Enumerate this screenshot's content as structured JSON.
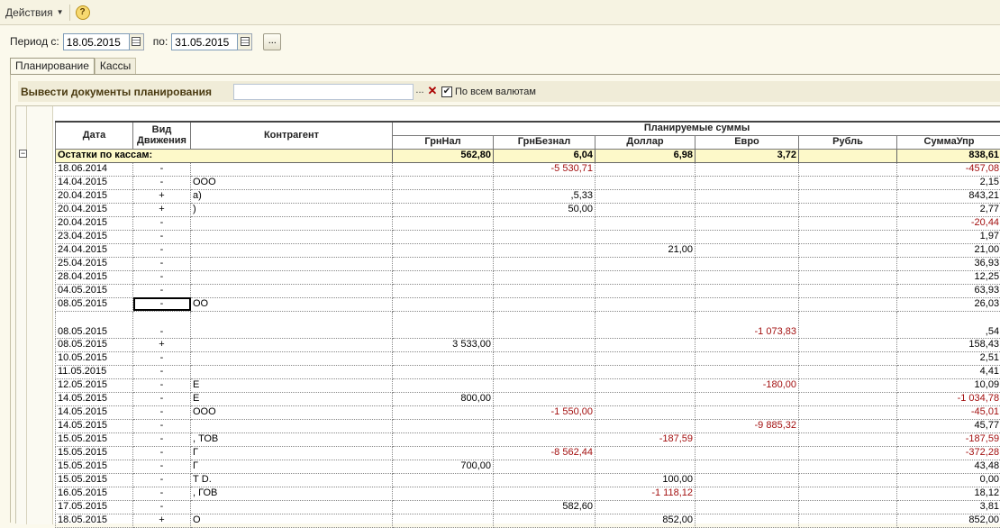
{
  "toolbar": {
    "actions_label": "Действия",
    "help_label": "?"
  },
  "period": {
    "from_label": "Период с:",
    "from_value": "18.05.2015",
    "to_label": "по:",
    "to_value": "31.05.2015",
    "more_label": "..."
  },
  "tabs": [
    {
      "label": "Планирование",
      "active": true
    },
    {
      "label": "Кассы",
      "active": false
    }
  ],
  "planning": {
    "label": "Вывести документы планирования",
    "field_value": "",
    "pick_label": "...",
    "clear_label": "✕",
    "all_currencies_label": "По всем валютам",
    "all_currencies_checked": true
  },
  "grid": {
    "headers": {
      "date": "Дата",
      "movement": "Вид Движения",
      "counterparty": "Контрагент",
      "planned": "Планируемые суммы",
      "grn_cash": "ГрнНал",
      "grn_noncash": "ГрнБезнал",
      "usd": "Доллар",
      "eur": "Евро",
      "rub": "Рубль",
      "total": "СуммаУпр"
    },
    "balance_row": {
      "label": "Остатки по кассам:",
      "grn_cash": "562,80",
      "grn_noncash": "6,04",
      "usd": "6,98",
      "eur": "3,72",
      "rub": "",
      "total": "838,61"
    },
    "rows": [
      {
        "date": "18.06.2014",
        "mv": "-",
        "cp": "",
        "grn_cash": "",
        "grn_noncash": "-5 530,71",
        "usd": "",
        "eur": "",
        "rub": "",
        "total": "-457,08"
      },
      {
        "date": "14.04.2015",
        "mv": "-",
        "cp": "ООО",
        "grn_cash": "",
        "grn_noncash": "",
        "usd": "",
        "eur": "",
        "rub": "",
        "total": "2,15"
      },
      {
        "date": "20.04.2015",
        "mv": "+",
        "cp": "а)",
        "grn_cash": "",
        "grn_noncash": ",5,33",
        "usd": "",
        "eur": "",
        "rub": "",
        "total": "843,21"
      },
      {
        "date": "20.04.2015",
        "mv": "+",
        "cp": ")",
        "grn_cash": "",
        "grn_noncash": "50,00",
        "usd": "",
        "eur": "",
        "rub": "",
        "total": "2,77"
      },
      {
        "date": "20.04.2015",
        "mv": "-",
        "cp": "",
        "grn_cash": "",
        "grn_noncash": "",
        "usd": "",
        "eur": "",
        "rub": "",
        "total": "-20,44"
      },
      {
        "date": "23.04.2015",
        "mv": "-",
        "cp": "",
        "grn_cash": "",
        "grn_noncash": "",
        "usd": "",
        "eur": "",
        "rub": "",
        "total": "1,97"
      },
      {
        "date": "24.04.2015",
        "mv": "-",
        "cp": "",
        "grn_cash": "",
        "grn_noncash": "",
        "usd": "21,00",
        "eur": "",
        "rub": "",
        "total": "21,00"
      },
      {
        "date": "25.04.2015",
        "mv": "-",
        "cp": "",
        "grn_cash": "",
        "grn_noncash": "",
        "usd": "",
        "eur": "",
        "rub": "",
        "total": "36,93"
      },
      {
        "date": "28.04.2015",
        "mv": "-",
        "cp": "",
        "grn_cash": "",
        "grn_noncash": "",
        "usd": "",
        "eur": "",
        "rub": "",
        "total": "12,25"
      },
      {
        "date": "04.05.2015",
        "mv": "-",
        "cp": "",
        "grn_cash": "",
        "grn_noncash": "",
        "usd": "",
        "eur": "",
        "rub": "",
        "total": "63,93"
      },
      {
        "date": "08.05.2015",
        "mv": "-",
        "cp": "ОО",
        "grn_cash": "",
        "grn_noncash": "",
        "usd": "",
        "eur": "",
        "rub": "",
        "total": "26,03",
        "selected": true
      },
      {
        "date": "08.05.2015",
        "mv": "-",
        "cp": "",
        "grn_cash": "",
        "grn_noncash": "",
        "usd": "",
        "eur": "-1 073,83",
        "rub": "",
        "total": ",54",
        "tall": true
      },
      {
        "date": "08.05.2015",
        "mv": "+",
        "cp": "",
        "grn_cash": "3 533,00",
        "grn_noncash": "",
        "usd": "",
        "eur": "",
        "rub": "",
        "total": "158,43"
      },
      {
        "date": "10.05.2015",
        "mv": "-",
        "cp": "",
        "grn_cash": "",
        "grn_noncash": "",
        "usd": "",
        "eur": "",
        "rub": "",
        "total": "2,51"
      },
      {
        "date": "11.05.2015",
        "mv": "-",
        "cp": "",
        "grn_cash": "",
        "grn_noncash": "",
        "usd": "",
        "eur": "",
        "rub": "",
        "total": "4,41"
      },
      {
        "date": "12.05.2015",
        "mv": "-",
        "cp": "Е",
        "grn_cash": "",
        "grn_noncash": "",
        "usd": "",
        "eur": "-180,00",
        "rub": "",
        "total": "10,09"
      },
      {
        "date": "14.05.2015",
        "mv": "-",
        "cp": "Е",
        "grn_cash": "800,00",
        "grn_noncash": "",
        "usd": "",
        "eur": "",
        "rub": "",
        "total": "-1 034,78"
      },
      {
        "date": "14.05.2015",
        "mv": "-",
        "cp": "ООО",
        "grn_cash": "",
        "grn_noncash": "-1 550,00",
        "usd": "",
        "eur": "",
        "rub": "",
        "total": "-45,01"
      },
      {
        "date": "14.05.2015",
        "mv": "-",
        "cp": "",
        "grn_cash": "",
        "grn_noncash": "",
        "usd": "",
        "eur": "-9 885,32",
        "rub": "",
        "total": "45,77"
      },
      {
        "date": "15.05.2015",
        "mv": "-",
        "cp": ", ТОВ",
        "grn_cash": "",
        "grn_noncash": "",
        "usd": "-187,59",
        "eur": "",
        "rub": "",
        "total": "-187,59"
      },
      {
        "date": "15.05.2015",
        "mv": "-",
        "cp": "Г",
        "grn_cash": "",
        "grn_noncash": "-8 562,44",
        "usd": "",
        "eur": "",
        "rub": "",
        "total": "-372,28"
      },
      {
        "date": "15.05.2015",
        "mv": "-",
        "cp": "Г",
        "grn_cash": "700,00",
        "grn_noncash": "",
        "usd": "",
        "eur": "",
        "rub": "",
        "total": "43,48"
      },
      {
        "date": "15.05.2015",
        "mv": "-",
        "cp": "Т D.",
        "grn_cash": "",
        "grn_noncash": "",
        "usd": "100,00",
        "eur": "",
        "rub": "",
        "total": "0,00"
      },
      {
        "date": "16.05.2015",
        "mv": "-",
        "cp": ", ГОВ",
        "grn_cash": "",
        "grn_noncash": "",
        "usd": "-1 118,12",
        "eur": "",
        "rub": "",
        "total": "18,12"
      },
      {
        "date": "17.05.2015",
        "mv": "-",
        "cp": "",
        "grn_cash": "",
        "grn_noncash": "582,60",
        "usd": "",
        "eur": "",
        "rub": "",
        "total": "3,81"
      },
      {
        "date": "18.05.2015",
        "mv": "+",
        "cp": "О",
        "grn_cash": "",
        "grn_noncash": "",
        "usd": "852,00",
        "eur": "",
        "rub": "",
        "total": "852,00"
      }
    ]
  },
  "colors": {
    "negative": "#a31010",
    "balance_bg": "#fdf9c9"
  },
  "icons": {
    "calendar": "calendar-icon",
    "help": "help-icon",
    "collapse": "collapse-icon"
  }
}
